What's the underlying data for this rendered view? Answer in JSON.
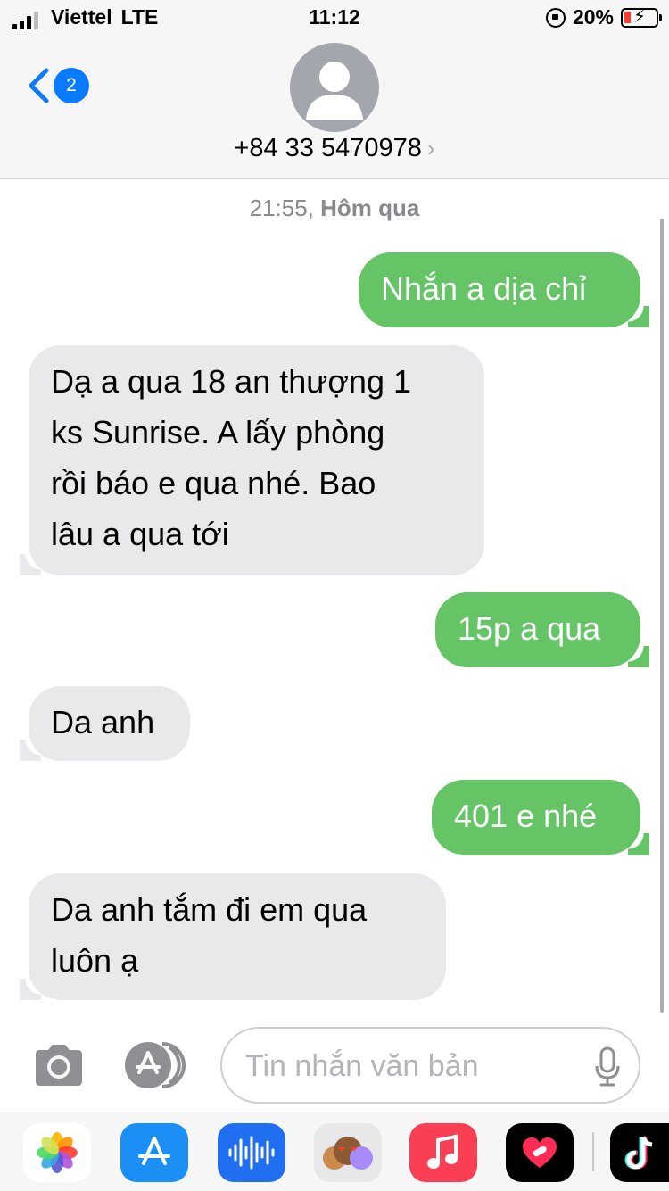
{
  "status_bar": {
    "carrier": "Viettel",
    "network": "LTE",
    "time": "11:12",
    "battery_percent": "20%"
  },
  "header": {
    "back_badge": "2",
    "contact": "+84 33 5470978"
  },
  "conversation": {
    "timestamp_time": "21:55,",
    "timestamp_day": "Hôm qua",
    "messages": [
      {
        "direction": "outgoing",
        "lines": [
          "Nhắn a dịa chỉ"
        ]
      },
      {
        "direction": "incoming",
        "lines": [
          "Dạ a qua 18 an thượng 1",
          "ks Sunrise. A lấy phòng",
          "rồi báo e qua nhé. Bao",
          "lâu a qua tới"
        ]
      },
      {
        "direction": "outgoing",
        "lines": [
          "15p a qua"
        ]
      },
      {
        "direction": "incoming",
        "lines": [
          "Da anh"
        ]
      },
      {
        "direction": "outgoing",
        "lines": [
          "401 e nhé"
        ]
      },
      {
        "direction": "incoming",
        "lines": [
          "Da anh tắm đi em qua",
          "luôn ạ"
        ]
      }
    ]
  },
  "composer": {
    "placeholder": "Tin nhắn văn bản"
  },
  "app_drawer": [
    "photos-app",
    "app-store-app",
    "audio-message-app",
    "memoji-app",
    "music-app",
    "digital-touch-app",
    "tiktok-app"
  ],
  "colors": {
    "outgoing_bubble": "#65c466",
    "incoming_bubble": "#e9e9eb",
    "accent": "#0a7aff"
  }
}
